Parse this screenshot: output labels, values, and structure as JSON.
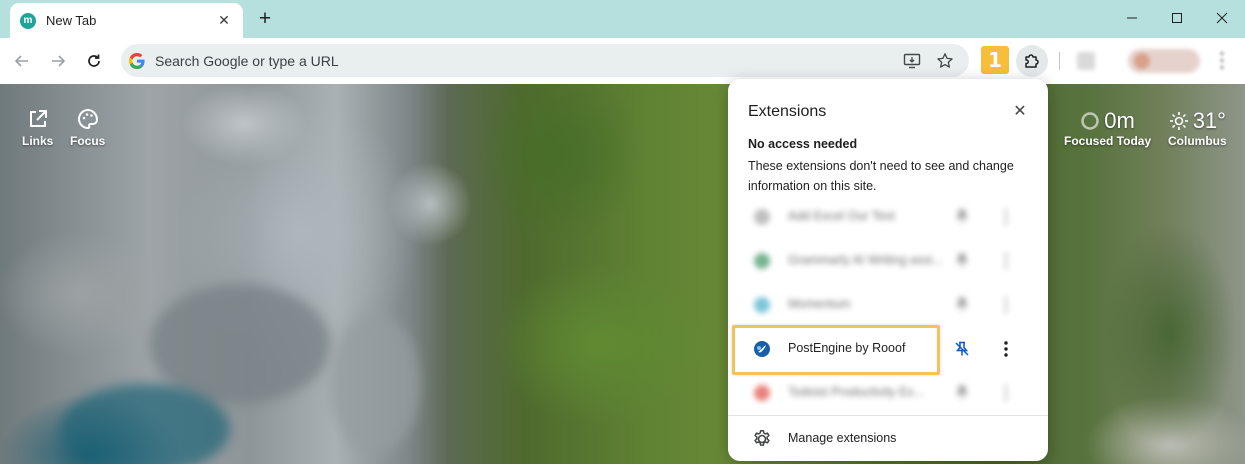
{
  "tab": {
    "favicon_letter": "m",
    "title": "New Tab",
    "close_glyph": "✕",
    "new_tab_glyph": "+"
  },
  "toolbar": {
    "omnibox_placeholder": "Search Google or type a URL",
    "step_badge": "1"
  },
  "page": {
    "links_label": "Links",
    "focus_label": "Focus",
    "focused_value": "0m",
    "focused_label": "Focused Today",
    "weather_value": "31°",
    "weather_label": "Columbus"
  },
  "extensions_popup": {
    "title": "Extensions",
    "close_glyph": "✕",
    "section_title": "No access needed",
    "section_description": "These extensions don't need to see and change information on this site.",
    "items": [
      {
        "name": "Add Excel Our Text",
        "icon_color": "#9e9e9e",
        "blurred": true
      },
      {
        "name": "Grammarly AI Writing assi...",
        "icon_color": "#2e8b57",
        "blurred": true
      },
      {
        "name": "Momentum",
        "icon_color": "#3aa6c5",
        "blurred": true
      },
      {
        "name": "PostEngine by Rooof",
        "icon_color": "#1a6fb5",
        "blurred": false,
        "pinned": true,
        "highlighted": true
      },
      {
        "name": "Todoist Productivity Ex...",
        "icon_color": "#db4035",
        "blurred": true
      }
    ],
    "manage_label": "Manage extensions"
  },
  "colors": {
    "tabstrip": "#b5e0dd",
    "omnibox": "#e9eeee",
    "badge": "#f6be3b",
    "highlight": "#f2c458",
    "pin_active": "#0b57d0"
  }
}
